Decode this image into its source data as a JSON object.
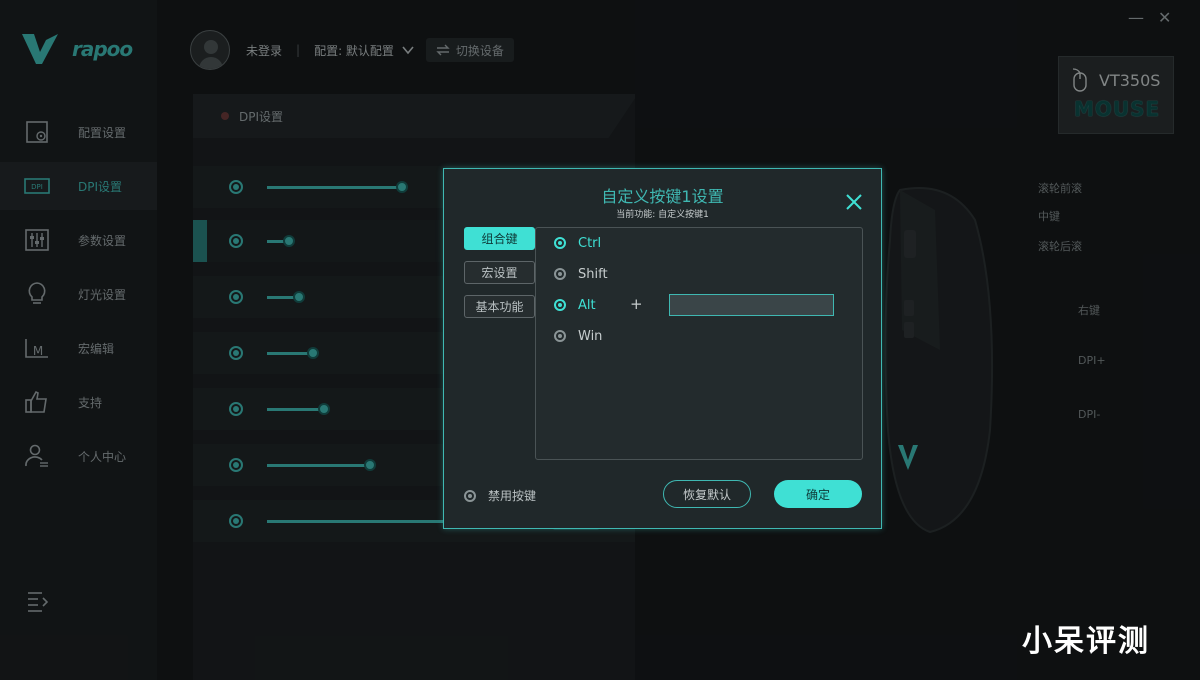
{
  "app": {
    "brand": "rapoo"
  },
  "window": {
    "minimize_glyph": "—",
    "close_glyph": "✕"
  },
  "sidebar": {
    "items": [
      {
        "label": "配置设置",
        "icon": "profile-settings-icon"
      },
      {
        "label": "DPI设置",
        "icon": "dpi-icon",
        "active": true
      },
      {
        "label": "参数设置",
        "icon": "sliders-icon"
      },
      {
        "label": "灯光设置",
        "icon": "lightbulb-icon"
      },
      {
        "label": "宏编辑",
        "icon": "macro-icon"
      },
      {
        "label": "支持",
        "icon": "thumbs-up-icon"
      },
      {
        "label": "个人中心",
        "icon": "user-icon"
      }
    ]
  },
  "topbar": {
    "login": "未登录",
    "separator": "|",
    "config": "配置: 默认配置",
    "switch_device": "切换设备"
  },
  "device": {
    "model": "VT350S",
    "type": "MOUSE"
  },
  "panel": {
    "title": "DPI设置",
    "levels": [
      0.5,
      0.08,
      0.12,
      0.17,
      0.21,
      0.38,
      1.0
    ],
    "selected_index": 1
  },
  "mouse_callouts": [
    "滚轮前滚",
    "中键",
    "滚轮后滚",
    "右键",
    "DPI+",
    "DPI-"
  ],
  "dialog": {
    "title": "自定义按键1设置",
    "subtitle": "当前功能: 自定义按键1",
    "tabs": [
      "组合键",
      "宏设置",
      "基本功能"
    ],
    "active_tab": 0,
    "modifiers": [
      {
        "label": "Ctrl",
        "checked": true
      },
      {
        "label": "Shift",
        "checked": false
      },
      {
        "label": "Alt",
        "checked": true
      },
      {
        "label": "Win",
        "checked": false
      }
    ],
    "plus": "+",
    "key_value": "",
    "disable_label": "禁用按键",
    "reset_label": "恢复默认",
    "ok_label": "确定"
  },
  "watermark": "小呆评测",
  "colors": {
    "accent": "#3fe0d4",
    "accent_dark": "#3fb8b2",
    "bg": "#16191b"
  }
}
